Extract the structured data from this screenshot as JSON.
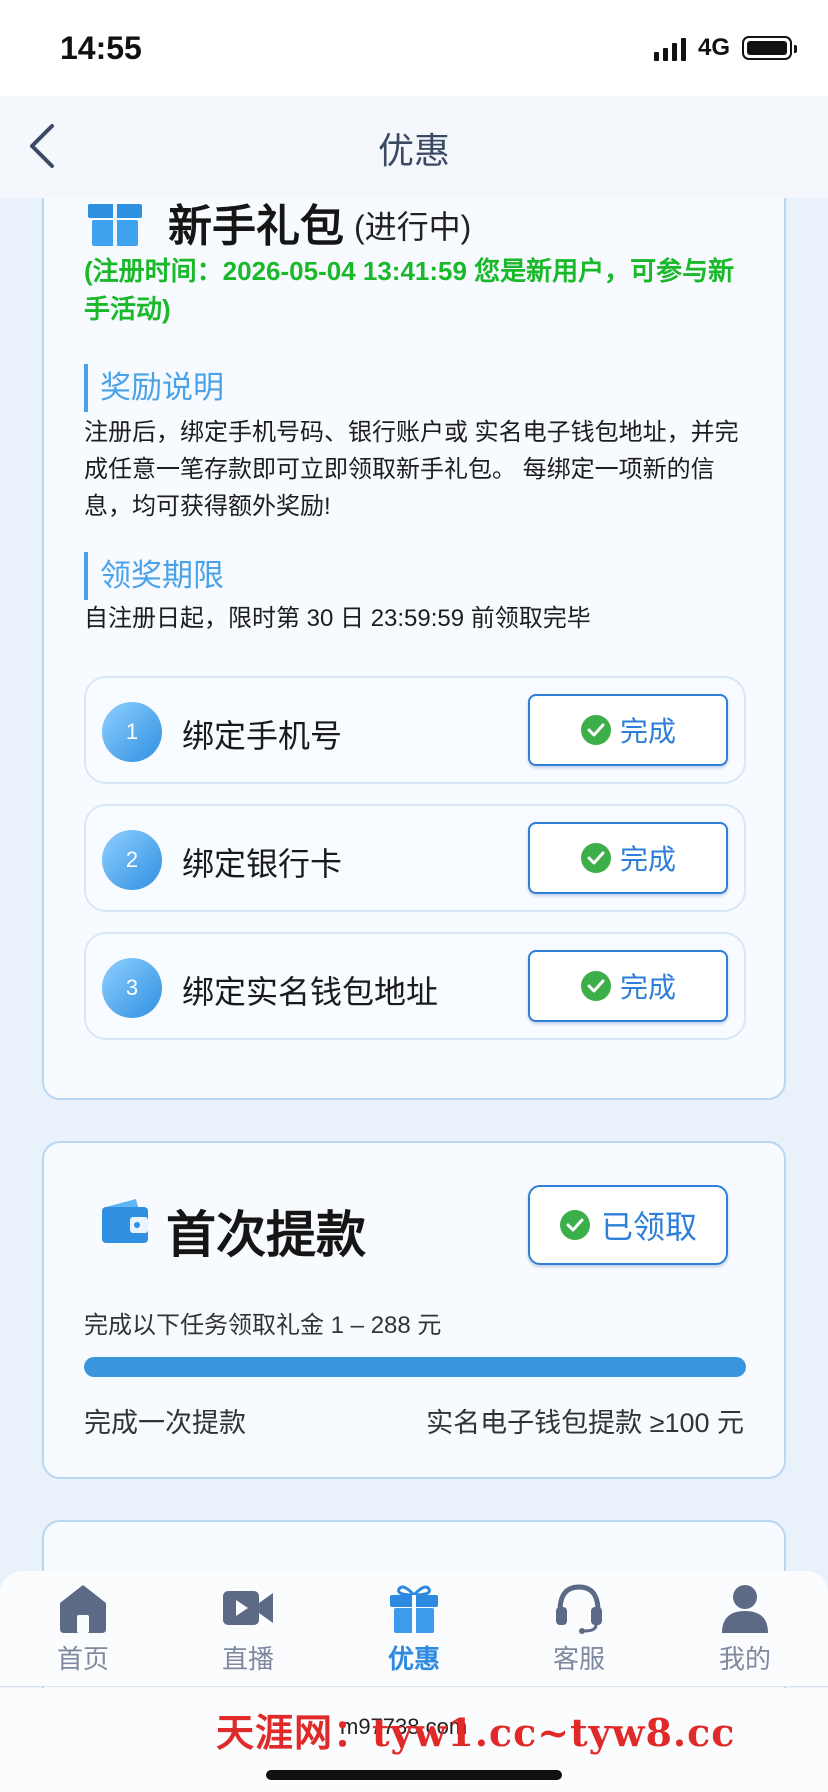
{
  "status_bar": {
    "time": "14:55",
    "network": "4G"
  },
  "nav": {
    "title": "优惠",
    "back_icon": "chevron-left-icon"
  },
  "newbie_card": {
    "icon": "gift-icon",
    "title": "新手礼包",
    "status": "(进行中)",
    "registration_note": "(注册时间：2026-05-04 13:41:59 您是新用户，可参与新手活动)",
    "reward_heading": "奖励说明",
    "reward_text": "注册后，绑定手机号码、银行账户或 实名电子钱包地址，并完成任意一笔存款即可立即领取新手礼包。 每绑定一项新的信息，均可获得额外奖励!",
    "deadline_heading": "领奖期限",
    "deadline_text": "自注册日起，限时第 30 日 23:59:59 前领取完毕",
    "tasks": [
      {
        "number": "1",
        "label": "绑定手机号",
        "button": "完成"
      },
      {
        "number": "2",
        "label": "绑定银行卡",
        "button": "完成"
      },
      {
        "number": "3",
        "label": "绑定实名钱包地址",
        "button": "完成"
      }
    ]
  },
  "withdraw_card": {
    "icon": "wallet-icon",
    "title": "首次提款",
    "button": "已领取",
    "description": "完成以下任务领取礼金 1 – 288 元",
    "progress": 1.0,
    "left_text": "完成一次提款",
    "right_text": "实名电子钱包提款 ≥100 元"
  },
  "tabs": [
    {
      "label": "首页",
      "icon": "home-icon",
      "active": false
    },
    {
      "label": "直播",
      "icon": "video-camera-icon",
      "active": false
    },
    {
      "label": "优惠",
      "icon": "gift-icon",
      "active": true
    },
    {
      "label": "客服",
      "icon": "headset-icon",
      "active": false
    },
    {
      "label": "我的",
      "icon": "user-icon",
      "active": false
    }
  ],
  "footer": {
    "url": "m97738.com",
    "watermark": "天涯网：tyw1.cc~tyw8.cc"
  },
  "colors": {
    "accent": "#2e7fd8",
    "success": "#19b92a",
    "progress": "#3b95dc",
    "background": "#e9f1fb"
  }
}
